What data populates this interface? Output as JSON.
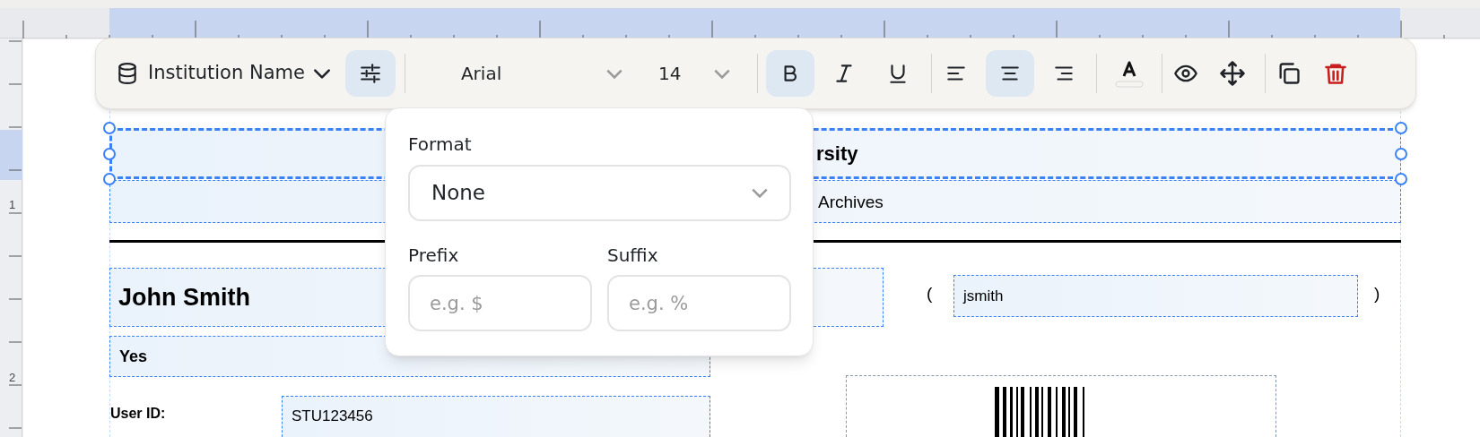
{
  "left_ruler": [
    "1",
    "2"
  ],
  "toolbar": {
    "field": {
      "label": "Institution Name"
    },
    "format_button": {
      "selected": true
    },
    "font": {
      "value": "Arial"
    },
    "size": {
      "value": "14"
    },
    "style_buttons": [
      {
        "kind": "bold",
        "selected": true
      },
      {
        "kind": "italic",
        "selected": false
      },
      {
        "kind": "underline",
        "selected": false
      }
    ],
    "align_buttons": [
      {
        "kind": "left",
        "selected": false
      },
      {
        "kind": "center",
        "selected": true
      },
      {
        "kind": "right",
        "selected": false
      }
    ],
    "actions": [
      {
        "kind": "text-color"
      },
      {
        "kind": "preview"
      },
      {
        "kind": "move"
      },
      {
        "kind": "duplicate"
      },
      {
        "kind": "delete"
      }
    ]
  },
  "format_popover": {
    "format_label": "Format",
    "format_value": "None",
    "prefix_label": "Prefix",
    "prefix_placeholder": "e.g. $",
    "suffix_label": "Suffix",
    "suffix_placeholder": "e.g. %"
  },
  "canvas": {
    "title": "rsity",
    "subtitle": "Archives",
    "name": "John Smith",
    "open_paren": "(",
    "username": "jsmith",
    "close_paren": ")",
    "flag": "Yes",
    "user_id_label": "User ID:",
    "user_id": "STU123456"
  }
}
